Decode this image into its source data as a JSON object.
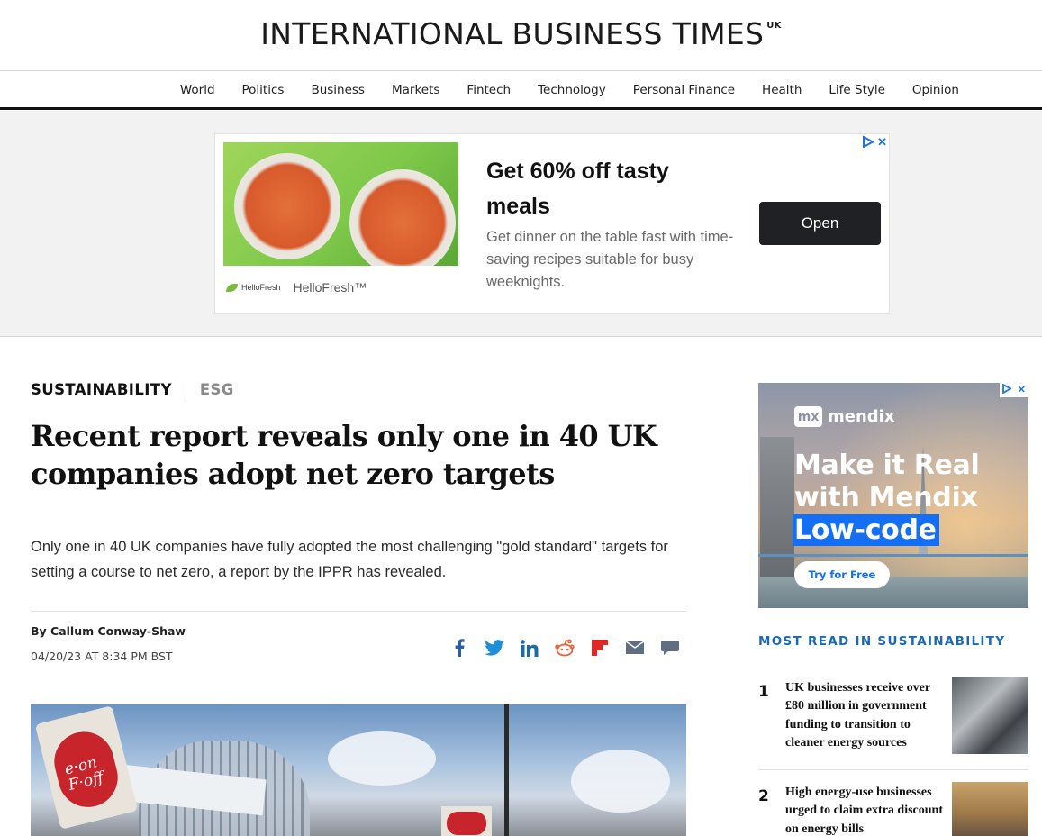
{
  "site": {
    "logo_text": "INTERNATIONAL BUSINESS TIMES",
    "logo_edition": "UK"
  },
  "nav": {
    "items": [
      "World",
      "Politics",
      "Business",
      "Markets",
      "Fintech",
      "Technology",
      "Personal Finance",
      "Health",
      "Life Style",
      "Opinion"
    ]
  },
  "top_ad": {
    "title": "Get 60% off tasty meals",
    "description": "Get dinner on the table fast with time-saving recipes suitable for busy weeknights.",
    "brand_small": "HelloFresh",
    "brand": "HelloFresh™",
    "cta": "Open",
    "choices_icon": "adchoices-icon",
    "close_symbol": "✕"
  },
  "article": {
    "section": "SUSTAINABILITY",
    "subsection": "ESG",
    "headline": "Recent report reveals only one in 40 UK companies adopt net zero targets",
    "lede": "Only one in 40 UK companies have fully adopted the most challenging \"gold standard\" targets for setting a course to net zero, a report by the IPPR has revealed.",
    "author": "By Callum Conway-Shaw",
    "date": "04/20/23 AT 8:34 PM BST",
    "hero_sign_text": "e·on F·off",
    "share_icons": [
      "facebook-icon",
      "twitter-icon",
      "linkedin-icon",
      "reddit-icon",
      "flipboard-icon",
      "email-icon",
      "comment-icon"
    ]
  },
  "side_ad": {
    "brand_box": "mx",
    "brand": "mendix",
    "headline_line1": "Make it Real",
    "headline_line2": "with Mendix",
    "headline_highlight": "Low-code",
    "cta": "Try for Free"
  },
  "most_read": {
    "title": "MOST READ IN SUSTAINABILITY",
    "items": [
      {
        "rank": "1",
        "text": "UK businesses receive over £80 million in government funding to transition to cleaner energy sources"
      },
      {
        "rank": "2",
        "text": "High energy-use businesses urged to claim extra discount on energy bills"
      }
    ]
  },
  "colors": {
    "accent_blue": "#1b68b3",
    "ad_blue": "#1a73e8",
    "mendix_blue": "#146ff4",
    "eon_red": "#c7242b"
  }
}
